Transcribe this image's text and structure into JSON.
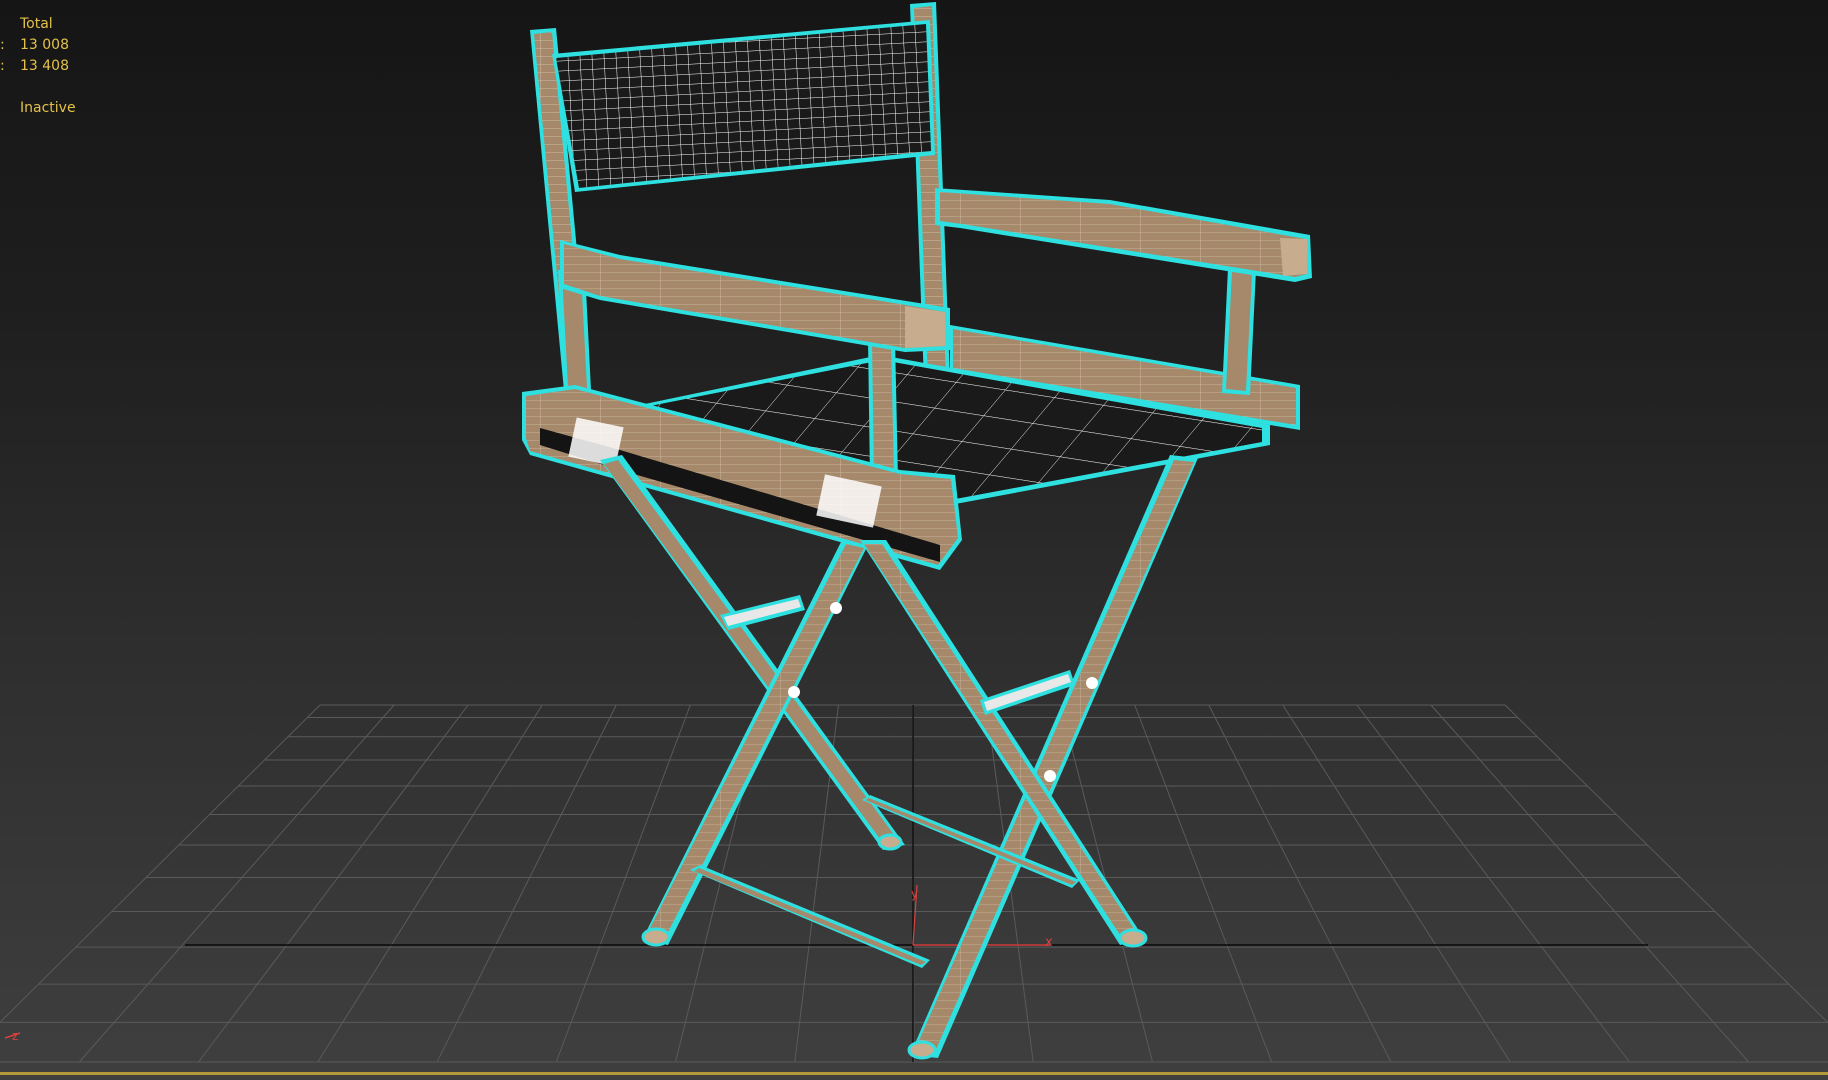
{
  "viewport": {
    "mode": "wireframe",
    "background_top": "#151515",
    "background_bottom": "#3f3f3f"
  },
  "stats": {
    "header": "Total",
    "polys_label": ":",
    "polys_value": "13 008",
    "verts_label": ":",
    "verts_value": "13 408",
    "status": "Inactive",
    "color": "#e3c14b"
  },
  "axes": {
    "x_label": "x",
    "y_label": "y",
    "corner_label": "z",
    "x_color": "#d94040",
    "grid_color": "#5a5a5a",
    "home_grid_line_color": "#0a0a0a"
  },
  "model": {
    "name": "director-chair",
    "wire_color": "#ffffff",
    "wood_color": "#a5896a",
    "fabric_color": "#1a1a1a",
    "selection_outline_color": "#2fe0e0"
  }
}
